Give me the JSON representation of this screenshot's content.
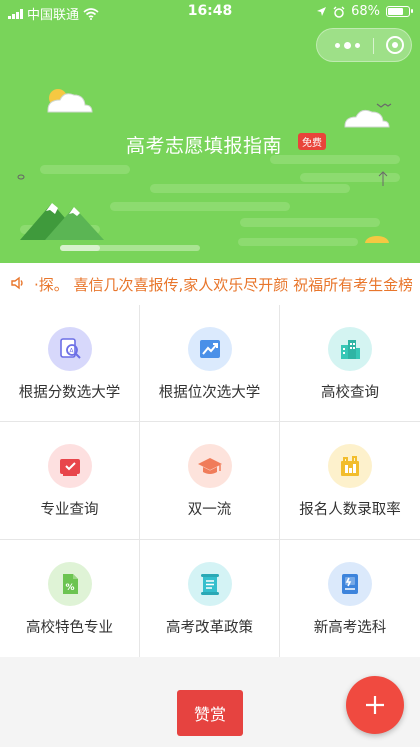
{
  "status_bar": {
    "carrier": "中国联通",
    "time": "16:48",
    "battery": "68%",
    "battery_level": 0.68
  },
  "capsule": {
    "more_icon": "more-dots-icon",
    "close_icon": "record-circle-icon"
  },
  "hero": {
    "title": "高考志愿填报指南",
    "badge": "免费",
    "background_color": "#79d45a"
  },
  "notice": {
    "icon": "speaker-icon",
    "text": "·探。 喜信几次喜报传,家人欢乐尽开颜 祝福所有考生金榜题名",
    "color": "#e8762c"
  },
  "menu": [
    {
      "label": "根据分数选大学",
      "icon": "score-search-icon",
      "bg": "#d7d8fb",
      "fg": "#6c6fe6"
    },
    {
      "label": "根据位次选大学",
      "icon": "rank-chart-icon",
      "bg": "#dbeafd",
      "fg": "#4a90e8"
    },
    {
      "label": "高校查询",
      "icon": "university-building-icon",
      "bg": "#d4f4f2",
      "fg": "#38c7b6"
    },
    {
      "label": "专业查询",
      "icon": "major-check-icon",
      "bg": "#fde0e0",
      "fg": "#e8454b"
    },
    {
      "label": "双一流",
      "icon": "graduation-cap-icon",
      "bg": "#fde3dc",
      "fg": "#f07c5a"
    },
    {
      "label": "报名人数录取率",
      "icon": "admission-stats-icon",
      "bg": "#fdf1cc",
      "fg": "#f2bd2c"
    },
    {
      "label": "高校特色专业",
      "icon": "percent-document-icon",
      "bg": "#dff3d6",
      "fg": "#6cc451"
    },
    {
      "label": "高考改革政策",
      "icon": "policy-scroll-icon",
      "bg": "#d4f3f5",
      "fg": "#35bfcd"
    },
    {
      "label": "新高考选科",
      "icon": "subject-book-icon",
      "bg": "#dbe9fb",
      "fg": "#3d84dc"
    }
  ],
  "bottom": {
    "reward_label": "赞赏",
    "fab_icon": "plus-icon",
    "accent": "#e64340"
  }
}
